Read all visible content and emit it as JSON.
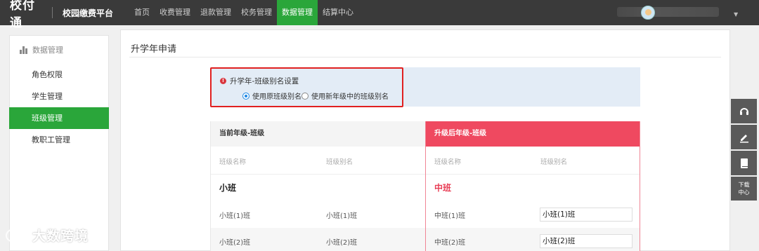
{
  "topbar": {
    "logo": "校付通",
    "platform_title": "校园缴费平台",
    "nav": [
      {
        "label": "首页"
      },
      {
        "label": "收费管理"
      },
      {
        "label": "退款管理"
      },
      {
        "label": "校务管理"
      },
      {
        "label": "数据管理"
      },
      {
        "label": "结算中心"
      }
    ],
    "active_nav": "数据管理"
  },
  "sidebar": {
    "section_title": "数据管理",
    "items": [
      {
        "label": "角色权限"
      },
      {
        "label": "学生管理"
      },
      {
        "label": "班级管理"
      },
      {
        "label": "教职工管理"
      }
    ],
    "active_item": "班级管理"
  },
  "main": {
    "title": "升学年申请",
    "setting": {
      "title": "升学年-班级别名设置",
      "options": [
        {
          "label": "使用原班级别名",
          "checked": true
        },
        {
          "label": "使用新年级中的班级别名",
          "checked": false
        }
      ]
    },
    "table": {
      "left_header": "当前年级-班级",
      "right_header": "升级后年级-班级",
      "col_class_name": "班级名称",
      "col_class_alias": "班级别名",
      "left_grade": "小班",
      "right_grade": "中班",
      "left_rows": [
        {
          "name": "小班(1)班",
          "alias": "小班(1)班"
        },
        {
          "name": "小班(2)班",
          "alias": "小班(2)班"
        }
      ],
      "right_rows": [
        {
          "name": "中班(1)班",
          "alias": "小班(1)班"
        },
        {
          "name": "中班(2)班",
          "alias": "小班(2)班"
        }
      ]
    }
  },
  "floatbar": {
    "download_label_1": "下载",
    "download_label_2": "中心",
    "icons": [
      "headset-icon",
      "edit-icon",
      "book-icon"
    ]
  },
  "watermark": {
    "text": "大数跨境"
  },
  "colors": {
    "topbar": "#3a3a3a",
    "accent_green": "#2aa63a",
    "accent_red": "#ef4960",
    "highlight_border": "#e02020",
    "setting_bg": "#e3ecf6"
  }
}
